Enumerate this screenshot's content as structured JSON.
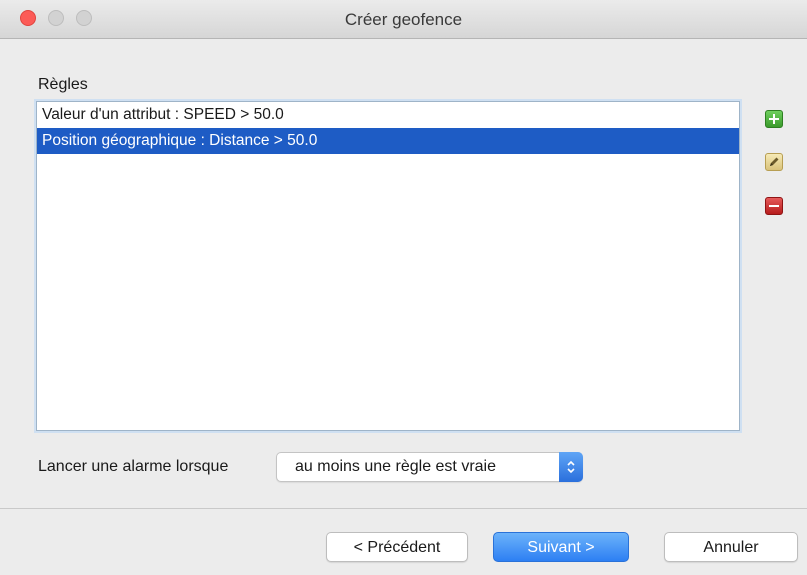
{
  "window": {
    "title": "Créer geofence"
  },
  "rules": {
    "label": "Règles",
    "items": [
      {
        "text": "Valeur d'un attribut : SPEED > 50.0",
        "selected": false
      },
      {
        "text": "Position géographique : Distance > 50.0",
        "selected": true
      }
    ],
    "actions": [
      {
        "icon": "plus-icon",
        "color": "#4caf3a"
      },
      {
        "icon": "pencil-icon",
        "color": "#e0cf8a"
      },
      {
        "icon": "minus-icon",
        "color": "#c62828"
      }
    ]
  },
  "alarm": {
    "label": "Lancer une alarme lorsque",
    "selected_value": "au moins une règle est vraie"
  },
  "footer": {
    "prev_label": "< Précédent",
    "next_label": "Suivant >",
    "cancel_label": "Annuler"
  },
  "colors": {
    "selection": "#1e5cc5",
    "primary_button": "#2d7ff3"
  }
}
